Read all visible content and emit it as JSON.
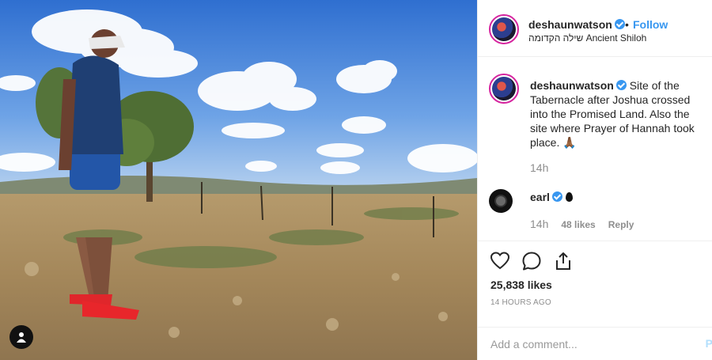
{
  "header": {
    "username": "deshaunwatson",
    "separator": "•",
    "follow_label": "Follow",
    "location": "שילה הקדומה Ancient Shiloh",
    "avatar_icon": "profile-avatar"
  },
  "caption": {
    "username": "deshaunwatson",
    "text": "Site of the Tabernacle after Joshua crossed into the Promised Land. Also the site where Prayer of Hannah took place. 🙏🏾",
    "time": "14h"
  },
  "comments": [
    {
      "username": "earl",
      "time": "14h",
      "likes": "48 likes",
      "reply_label": "Reply"
    }
  ],
  "actions": {
    "like_icon": "heart-icon",
    "comment_icon": "speech-bubble-icon",
    "share_icon": "share-icon",
    "likes_count": "25,838 likes",
    "timestamp": "14 HOURS AGO"
  },
  "comment_box": {
    "placeholder": "Add a comment...",
    "post_label": "P"
  },
  "colors": {
    "accent": "#3897f0",
    "text": "#262626",
    "muted": "#8e8e8e",
    "border": "#efefef"
  }
}
